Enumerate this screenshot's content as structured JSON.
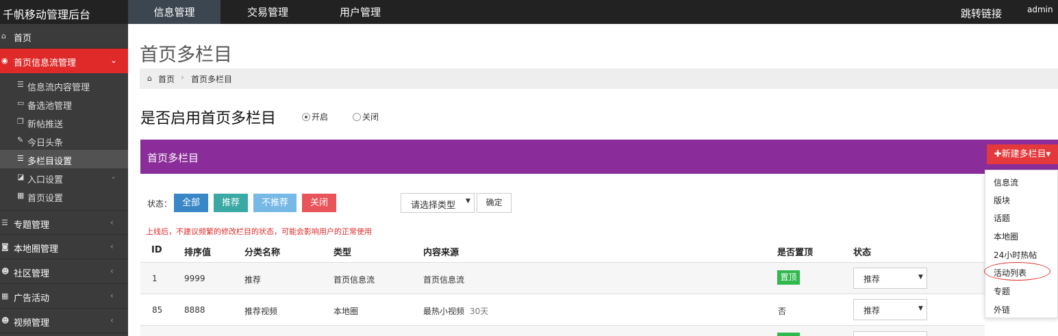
{
  "app": {
    "title": "千帆移动管理后台"
  },
  "top_nav": {
    "items": [
      {
        "label": "信息管理",
        "active": true
      },
      {
        "label": "交易管理",
        "active": false
      },
      {
        "label": "用户管理",
        "active": false
      }
    ],
    "jump_link": "跳转链接",
    "user": "admin"
  },
  "sidebar": {
    "home": {
      "label": "首页",
      "icon": "home-icon"
    },
    "feed": {
      "label": "首页信息流管理",
      "icon": "rss-icon"
    },
    "sub_items": [
      {
        "label": "信息流内容管理",
        "icon": "list-icon"
      },
      {
        "label": "备选池管理",
        "icon": "inbox-icon"
      },
      {
        "label": "新帖推送",
        "icon": "copy-icon"
      },
      {
        "label": "今日头条",
        "icon": "fire-icon"
      },
      {
        "label": "多栏目设置",
        "icon": "list-icon"
      },
      {
        "label": "入口设置",
        "icon": "edit-icon"
      },
      {
        "label": "首页设置",
        "icon": "grid-icon"
      }
    ],
    "sections": [
      {
        "label": "专题管理",
        "icon": "list-icon"
      },
      {
        "label": "本地圈管理",
        "icon": "camera-icon"
      },
      {
        "label": "社区管理",
        "icon": "users-icon"
      },
      {
        "label": "广告活动",
        "icon": "calendar-icon"
      },
      {
        "label": "视频管理",
        "icon": "users-icon"
      }
    ]
  },
  "page": {
    "title": "首页多栏目",
    "breadcrumb": [
      "首页",
      "首页多栏目"
    ]
  },
  "enable": {
    "label": "是否启用首页多栏目",
    "options": [
      "开启",
      "关闭"
    ],
    "selected": "开启"
  },
  "panel": {
    "title": "首页多栏目",
    "new_button": "✚新建多栏目▾"
  },
  "filter": {
    "status_label": "状态：",
    "buttons": [
      "全部",
      "推荐",
      "不推荐",
      "关闭"
    ],
    "type_placeholder": "请选择类型",
    "confirm": "确定"
  },
  "warning": "上线后，不建议频繁的修改栏目的状态，可能会影响用户的正常使用",
  "table": {
    "headers": [
      "ID",
      "排序值",
      "分类名称",
      "类型",
      "内容来源",
      "是否置顶",
      "状态"
    ],
    "rows": [
      {
        "id": "1",
        "sort": "9999",
        "name": "推荐",
        "type": "首页信息流",
        "source": "首页信息流",
        "days": "",
        "pinned": "置顶",
        "status": "推荐"
      },
      {
        "id": "85",
        "sort": "8888",
        "name": "推荐视频",
        "type": "本地圈",
        "source": "最热小视频",
        "days": "30天",
        "pinned": "否",
        "status": "推荐"
      }
    ]
  },
  "dropdown": {
    "items": [
      "信息流",
      "版块",
      "话题",
      "本地圈",
      "24小时热帖",
      "活动列表",
      "专题",
      "外链"
    ],
    "highlighted": "活动列表"
  },
  "colors": {
    "topbar": "#222222",
    "sidebar": "#3b3b3b",
    "sidebar_active": "#e02a2a",
    "panel_header": "#8a2c99",
    "new_button": "#e4393c",
    "btn_all": "#3a87c8",
    "btn_recommend": "#3aa9a4",
    "btn_not_recommend": "#76b8e6",
    "btn_close": "#e9545a",
    "pinned_badge": "#2fb94d"
  }
}
